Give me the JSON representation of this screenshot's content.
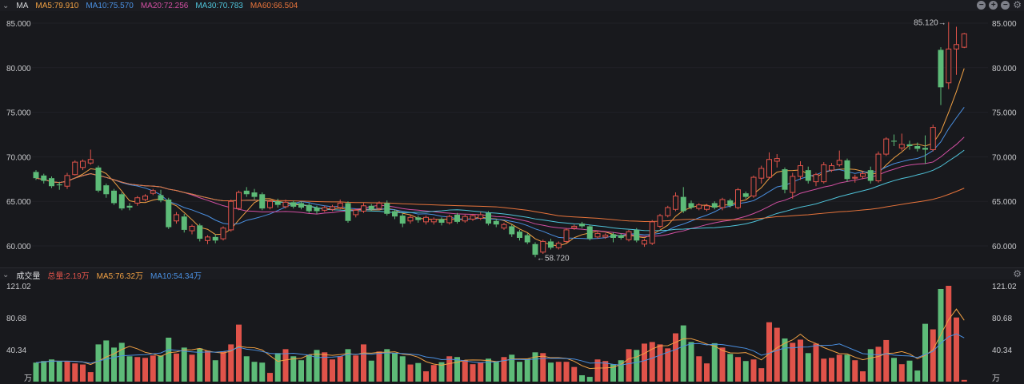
{
  "header": {
    "indicator": "MA",
    "ma5": "MA5:79.910",
    "ma10": "MA10:75.570",
    "ma20": "MA20:72.256",
    "ma30": "MA30:70.783",
    "ma60": "MA60:66.504"
  },
  "volume_header": {
    "title": "成交量",
    "total": "总量:2.19万",
    "ma5": "MA5:76.32万",
    "ma10": "MA10:54.34万"
  },
  "icons": [
    "chevron-down-icon",
    "zoom-out-icon",
    "zoom-in-icon",
    "minus-icon",
    "gear-icon"
  ],
  "colors": {
    "up": "#e0534a",
    "down": "#5dbb78",
    "ma5": "#f0a043",
    "ma10": "#4a8fe0",
    "ma20": "#d24fa2",
    "ma30": "#4fc3d9",
    "ma60": "#e8743b",
    "background": "#18191d"
  },
  "chart_data": [
    {
      "type": "candlestick",
      "title": "MA",
      "ylim": [
        58,
        86
      ],
      "y_ticks": [
        "85.000",
        "80.000",
        "75.000",
        "70.000",
        "65.000",
        "60.000"
      ],
      "y_tick_values": [
        85,
        80,
        75,
        70,
        65,
        60
      ],
      "annotations": {
        "max_label": "85.120→",
        "min_label": "←58.720"
      },
      "ma_periods": [
        5,
        10,
        20,
        30,
        60
      ],
      "ohlc": [
        [
          68.3,
          68.5,
          67.4,
          67.6
        ],
        [
          67.9,
          68.1,
          67.0,
          67.3
        ],
        [
          67.6,
          67.8,
          66.5,
          66.7
        ],
        [
          66.9,
          67.2,
          66.3,
          66.8
        ],
        [
          66.7,
          68.2,
          66.4,
          67.9
        ],
        [
          68.0,
          69.6,
          67.9,
          69.4
        ],
        [
          68.8,
          69.7,
          68.5,
          69.5
        ],
        [
          69.3,
          70.8,
          69.1,
          69.7
        ],
        [
          68.8,
          69.0,
          66.0,
          66.2
        ],
        [
          66.8,
          67.0,
          65.4,
          65.8
        ],
        [
          66.2,
          66.4,
          64.6,
          64.8
        ],
        [
          65.8,
          66.0,
          64.0,
          64.2
        ],
        [
          64.5,
          64.8,
          64.0,
          64.3
        ],
        [
          64.8,
          65.6,
          64.5,
          65.4
        ],
        [
          65.2,
          65.8,
          65.0,
          65.6
        ],
        [
          65.9,
          66.4,
          65.7,
          66.2
        ],
        [
          65.7,
          66.3,
          64.9,
          65.1
        ],
        [
          65.2,
          65.4,
          61.9,
          62.1
        ],
        [
          62.8,
          63.8,
          62.5,
          63.5
        ],
        [
          63.3,
          63.6,
          61.5,
          61.8
        ],
        [
          61.7,
          62.4,
          61.3,
          62.2
        ],
        [
          62.3,
          62.5,
          60.5,
          60.8
        ],
        [
          60.6,
          61.2,
          60.2,
          61.0
        ],
        [
          61.0,
          61.3,
          60.3,
          60.6
        ],
        [
          60.8,
          62.2,
          60.6,
          62.0
        ],
        [
          61.8,
          65.2,
          61.6,
          65.0
        ],
        [
          64.2,
          66.2,
          64.0,
          66.0
        ],
        [
          66.2,
          66.6,
          65.5,
          65.8
        ],
        [
          66.0,
          66.4,
          65.2,
          65.5
        ],
        [
          65.8,
          66.0,
          64.0,
          64.2
        ],
        [
          64.3,
          65.2,
          64.1,
          65.0
        ],
        [
          65.0,
          65.3,
          64.3,
          64.6
        ],
        [
          64.4,
          65.2,
          64.2,
          64.9
        ],
        [
          64.9,
          65.1,
          64.2,
          64.4
        ],
        [
          64.8,
          65.0,
          64.1,
          64.3
        ],
        [
          64.6,
          64.8,
          63.7,
          63.9
        ],
        [
          64.3,
          64.5,
          63.6,
          63.9
        ],
        [
          64.0,
          64.5,
          63.8,
          64.3
        ],
        [
          64.1,
          64.6,
          63.9,
          64.4
        ],
        [
          64.3,
          65.2,
          64.1,
          64.8
        ],
        [
          64.8,
          65.0,
          62.6,
          62.8
        ],
        [
          63.5,
          64.2,
          63.2,
          64.0
        ],
        [
          63.9,
          64.8,
          63.7,
          64.5
        ],
        [
          64.5,
          64.7,
          63.9,
          64.1
        ],
        [
          64.2,
          65.0,
          64.0,
          64.8
        ],
        [
          64.8,
          65.1,
          63.4,
          63.6
        ],
        [
          63.9,
          64.1,
          63.0,
          63.3
        ],
        [
          63.4,
          63.6,
          62.1,
          62.5
        ],
        [
          62.8,
          63.5,
          62.5,
          63.2
        ],
        [
          63.2,
          63.4,
          62.6,
          62.9
        ],
        [
          62.7,
          63.4,
          62.4,
          63.2
        ],
        [
          62.7,
          63.2,
          62.4,
          63.0
        ],
        [
          63.0,
          63.2,
          62.3,
          62.6
        ],
        [
          62.6,
          63.5,
          62.4,
          63.3
        ],
        [
          63.5,
          63.7,
          62.5,
          62.7
        ],
        [
          62.8,
          63.5,
          62.6,
          63.3
        ],
        [
          63.0,
          63.6,
          62.8,
          63.4
        ],
        [
          63.1,
          63.8,
          62.9,
          63.5
        ],
        [
          63.7,
          63.9,
          62.3,
          62.5
        ],
        [
          62.8,
          63.0,
          62.1,
          62.4
        ],
        [
          62.0,
          62.6,
          61.8,
          62.4
        ],
        [
          62.2,
          62.4,
          61.0,
          61.3
        ],
        [
          61.6,
          61.8,
          60.6,
          60.9
        ],
        [
          61.2,
          61.4,
          60.2,
          60.4
        ],
        [
          60.2,
          60.4,
          58.72,
          59.0
        ],
        [
          59.3,
          60.7,
          59.1,
          60.5
        ],
        [
          60.5,
          60.8,
          59.6,
          59.8
        ],
        [
          59.8,
          60.5,
          59.6,
          60.3
        ],
        [
          60.5,
          62.0,
          60.3,
          61.8
        ],
        [
          62.0,
          62.4,
          61.8,
          62.2
        ],
        [
          62.5,
          62.7,
          62.0,
          62.2
        ],
        [
          62.2,
          62.4,
          60.6,
          60.8
        ],
        [
          61.0,
          61.6,
          60.8,
          61.4
        ],
        [
          61.0,
          61.4,
          60.8,
          61.2
        ],
        [
          61.3,
          61.5,
          60.4,
          60.9
        ],
        [
          61.2,
          61.4,
          60.7,
          60.9
        ],
        [
          60.7,
          61.8,
          60.5,
          61.6
        ],
        [
          61.8,
          62.0,
          60.4,
          60.6
        ],
        [
          60.2,
          60.8,
          59.9,
          60.6
        ],
        [
          60.3,
          62.9,
          60.1,
          62.7
        ],
        [
          62.2,
          63.6,
          62.0,
          63.4
        ],
        [
          63.4,
          64.5,
          63.2,
          64.3
        ],
        [
          64.1,
          66.0,
          63.9,
          65.6
        ],
        [
          65.5,
          66.6,
          63.7,
          63.9
        ],
        [
          64.8,
          65.1,
          64.1,
          64.3
        ],
        [
          64.2,
          64.8,
          64.0,
          64.6
        ],
        [
          64.1,
          64.7,
          63.9,
          64.5
        ],
        [
          64.8,
          65.0,
          64.1,
          64.3
        ],
        [
          64.3,
          65.4,
          64.0,
          65.2
        ],
        [
          65.1,
          65.3,
          64.3,
          64.5
        ],
        [
          64.3,
          66.5,
          64.1,
          66.3
        ],
        [
          65.9,
          66.1,
          65.3,
          65.5
        ],
        [
          65.6,
          67.9,
          65.4,
          67.7
        ],
        [
          67.6,
          69.0,
          67.0,
          68.7
        ],
        [
          67.7,
          70.5,
          67.5,
          69.7
        ],
        [
          69.5,
          70.3,
          68.8,
          69.8
        ],
        [
          68.6,
          68.8,
          65.9,
          66.3
        ],
        [
          66.0,
          68.2,
          65.3,
          67.8
        ],
        [
          67.8,
          69.5,
          67.4,
          69.0
        ],
        [
          68.5,
          68.9,
          67.0,
          67.3
        ],
        [
          67.2,
          68.2,
          66.7,
          68.0
        ],
        [
          67.2,
          69.4,
          67.0,
          69.1
        ],
        [
          68.5,
          69.3,
          68.3,
          69.0
        ],
        [
          69.1,
          70.7,
          68.9,
          69.6
        ],
        [
          69.6,
          69.8,
          67.2,
          67.5
        ],
        [
          67.6,
          68.0,
          67.1,
          67.7
        ],
        [
          67.8,
          68.4,
          67.5,
          68.1
        ],
        [
          68.5,
          68.9,
          67.0,
          67.3
        ],
        [
          67.3,
          70.6,
          67.1,
          70.3
        ],
        [
          70.3,
          72.2,
          70.1,
          72.0
        ],
        [
          71.8,
          72.5,
          71.2,
          71.7
        ],
        [
          71.0,
          72.6,
          70.7,
          71.4
        ],
        [
          71.4,
          71.8,
          70.8,
          71.2
        ],
        [
          71.2,
          71.6,
          70.6,
          70.9
        ],
        [
          71.0,
          72.4,
          69.2,
          70.8
        ],
        [
          70.8,
          73.6,
          70.6,
          73.3
        ],
        [
          82.0,
          82.3,
          75.8,
          77.8
        ],
        [
          78.3,
          85.12,
          77.6,
          82.1
        ],
        [
          82.1,
          84.6,
          79.2,
          82.6
        ],
        [
          82.3,
          83.9,
          82.2,
          83.8
        ]
      ]
    },
    {
      "type": "bar",
      "title": "成交量",
      "unit": "万",
      "ylim": [
        0,
        121.02
      ],
      "y_ticks": [
        "121.02",
        "80.68",
        "40.34"
      ],
      "y_tick_values": [
        121.02,
        80.68,
        40.34
      ],
      "unit_label": "万",
      "ma_periods": [
        5,
        10
      ],
      "values": [
        24,
        26,
        28,
        25.5,
        26,
        23,
        21.6,
        12,
        47,
        52,
        43,
        49,
        32,
        31,
        30,
        33,
        33,
        55.5,
        35.5,
        43,
        34,
        42,
        39,
        27,
        38,
        47,
        72,
        32,
        25,
        24,
        11,
        36,
        41,
        32,
        27,
        34,
        40,
        37,
        28,
        32,
        41,
        33,
        47,
        26.5,
        38,
        41,
        36,
        32,
        21.6,
        23.5,
        13,
        21,
        24.5,
        32,
        31,
        27,
        22,
        24,
        29,
        25,
        31,
        34,
        25,
        29,
        37,
        36,
        24,
        25,
        25,
        18.5,
        8,
        6,
        28,
        26,
        22,
        27,
        41,
        40,
        48,
        50,
        47,
        42,
        61,
        71,
        50,
        32,
        23,
        48.5,
        43,
        35,
        31,
        26,
        28,
        17,
        75,
        68,
        54.5,
        49,
        53,
        36,
        48,
        29,
        30,
        34,
        34,
        27,
        13,
        41,
        44,
        52.5,
        30,
        22,
        26.5,
        14,
        73,
        66,
        117,
        121.02,
        81,
        2.19
      ]
    }
  ]
}
